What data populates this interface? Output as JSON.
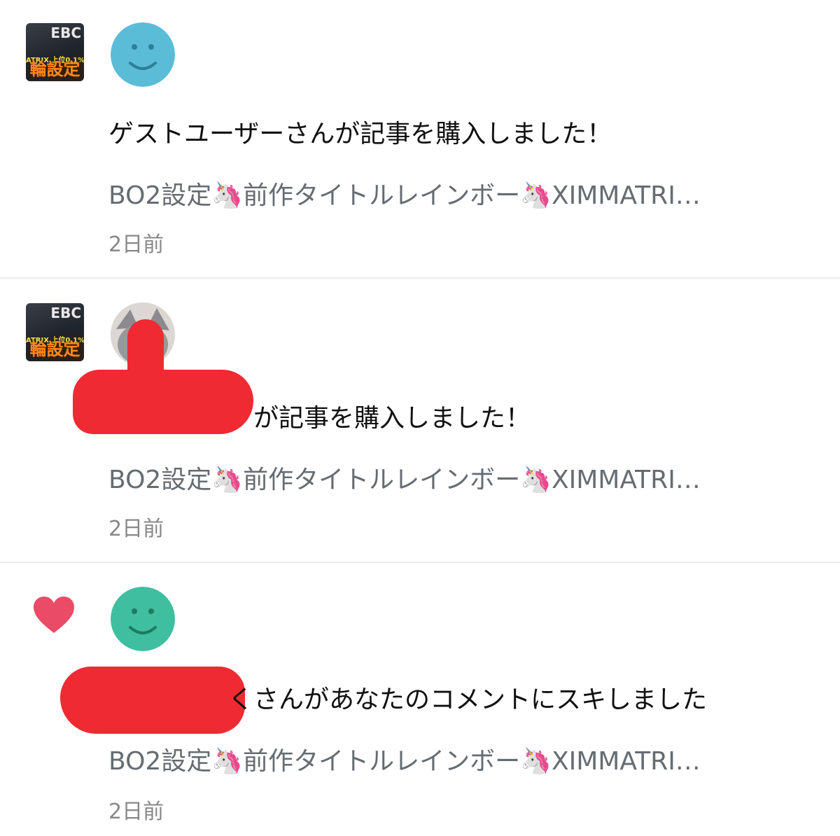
{
  "colors": {
    "smile_blue": "#5bbcd8",
    "smile_green": "#3fbf9f",
    "heart": "#ea4b67",
    "redaction": "#f02a32"
  },
  "thumbnail": {
    "top_text": "EBC",
    "mid_text": "ATRIX 上位0.1%の",
    "main_text": "輪設定"
  },
  "notifications": [
    {
      "type": "purchase",
      "left_icon": "article-thumbnail",
      "avatar": "smile-blue-icon",
      "title": "ゲストユーザーさんが記事を購入しました！",
      "article": "BO2設定🦄前作タイトルレインボー🦄XIMMATRI…",
      "time": "2日前"
    },
    {
      "type": "purchase",
      "left_icon": "article-thumbnail",
      "avatar": "user-photo",
      "title": "が記事を購入しました！",
      "article": "BO2設定🦄前作タイトルレインボー🦄XIMMATRI…",
      "time": "2日前"
    },
    {
      "type": "like",
      "left_icon": "heart-icon",
      "avatar": "smile-green-icon",
      "title": "くさんがあなたのコメントにスキしました",
      "article": "BO2設定🦄前作タイトルレインボー🦄XIMMATRI…",
      "time": "2日前"
    }
  ]
}
